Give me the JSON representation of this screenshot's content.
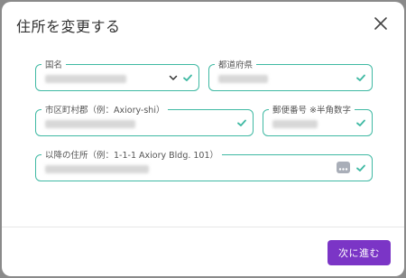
{
  "modal": {
    "title": "住所を変更する",
    "next_button": "次に進む"
  },
  "fields": {
    "country_label": "国名",
    "prefecture_label": "都道府県",
    "city_label": "市区町村郡（例：Axiory-shi）",
    "postal_label": "郵便番号 ※半角数字",
    "address_label": "以降の住所（例：1-1-1 Axiory Bldg. 101）"
  },
  "icons": {
    "close": "close-icon",
    "check": "check-icon",
    "chevron": "chevron-down-icon",
    "more": "dots-icon"
  },
  "colors": {
    "accent": "#3fb9a3",
    "primary_button": "#7b35c6"
  }
}
